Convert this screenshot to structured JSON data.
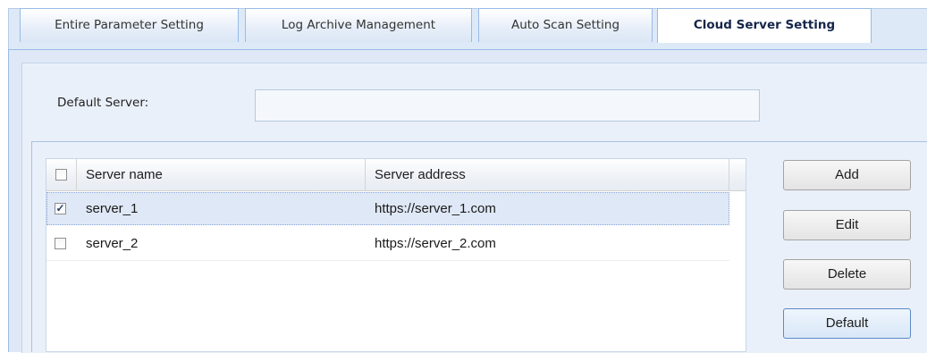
{
  "tabs": [
    {
      "label": "Entire Parameter Setting"
    },
    {
      "label": "Log Archive Management"
    },
    {
      "label": "Auto Scan Setting"
    },
    {
      "label": "Cloud Server Setting",
      "active": true
    }
  ],
  "default_server": {
    "label": "Default Server:",
    "value": ""
  },
  "grid": {
    "columns": [
      "Server name",
      "Server address"
    ],
    "rows": [
      {
        "name": "server_1",
        "address": "https://server_1.com",
        "checked": true,
        "selected": true
      },
      {
        "name": "server_2",
        "address": "https://server_2.com",
        "checked": false,
        "selected": false
      }
    ]
  },
  "buttons": {
    "add": "Add",
    "edit": "Edit",
    "delete": "Delete",
    "default": "Default"
  },
  "icons": {
    "checkbox_checked": "checkbox-checked-icon",
    "checkbox_unchecked": "checkbox-unchecked-icon"
  }
}
